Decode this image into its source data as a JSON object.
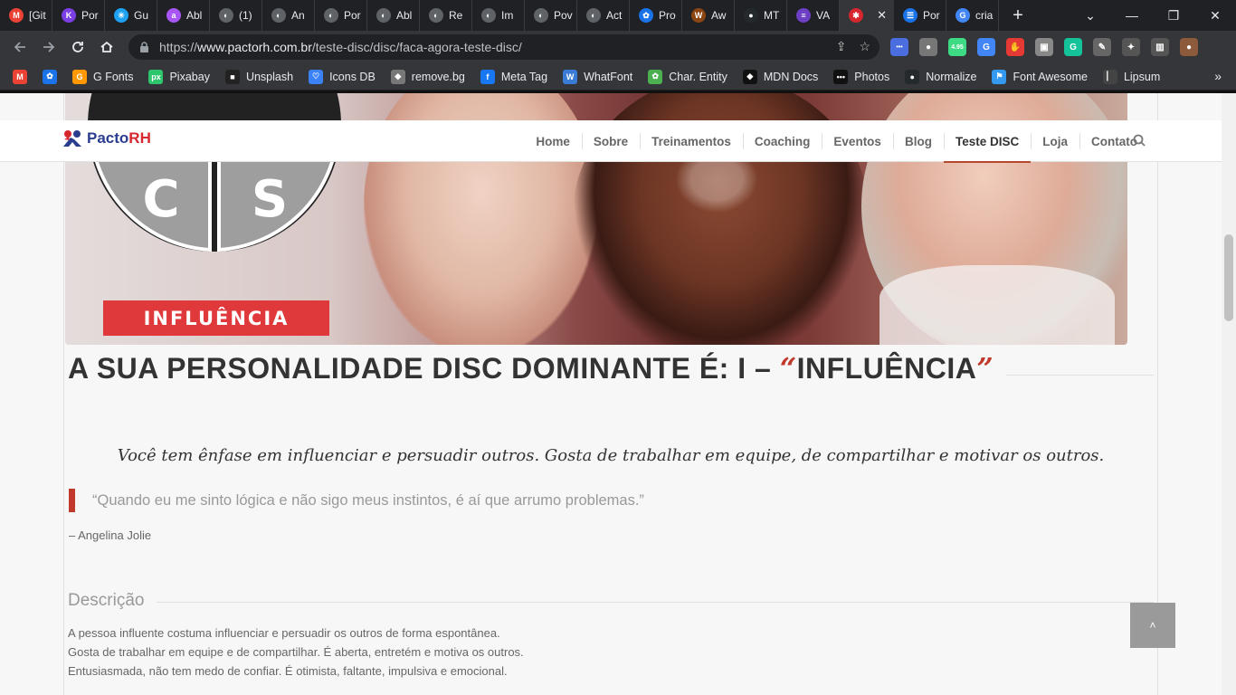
{
  "browser": {
    "tabs": [
      {
        "label": "[Git",
        "fav": "M",
        "color": "#ea4335"
      },
      {
        "label": "Por",
        "fav": "K",
        "color": "#7b3fe4"
      },
      {
        "label": "Gu",
        "fav": "✳",
        "color": "#1da1f2"
      },
      {
        "label": "Abl",
        "fav": "a",
        "color": "#a855f7"
      },
      {
        "label": "(1)",
        "fav": "◐",
        "color": "#5f6368"
      },
      {
        "label": "An",
        "fav": "◐",
        "color": "#5f6368"
      },
      {
        "label": "Por",
        "fav": "◐",
        "color": "#5f6368"
      },
      {
        "label": "Abl",
        "fav": "◐",
        "color": "#5f6368"
      },
      {
        "label": "Re",
        "fav": "◐",
        "color": "#5f6368"
      },
      {
        "label": "Im",
        "fav": "◐",
        "color": "#5f6368"
      },
      {
        "label": "Pov",
        "fav": "◐",
        "color": "#5f6368"
      },
      {
        "label": "Act",
        "fav": "◐",
        "color": "#5f6368"
      },
      {
        "label": "Pro",
        "fav": "✿",
        "color": "#1a73e8"
      },
      {
        "label": "Aw",
        "fav": "W",
        "color": "#8b4513"
      },
      {
        "label": "MT",
        "fav": "●",
        "color": "#24292e"
      },
      {
        "label": "VA",
        "fav": "≡",
        "color": "#6c3fc4"
      },
      {
        "label": "",
        "fav": "✱",
        "color": "#d6262e",
        "active": true
      },
      {
        "label": "Por",
        "fav": "☰",
        "color": "#1a73e8"
      },
      {
        "label": "cria",
        "fav": "G",
        "color": "#4285f4"
      }
    ],
    "new_tab": "+",
    "window_controls": {
      "chevron": "⌄",
      "minimize": "—",
      "restore": "❐",
      "close": "✕"
    },
    "url": {
      "scheme": "https://",
      "host": "www.pactorh.com.br",
      "path": "/teste-disc/disc/faca-agora-teste-disc/"
    },
    "extensions": [
      {
        "icon": "extension-dots-icon",
        "glyph": "•••",
        "color": "#4a6ee0"
      },
      {
        "icon": "extension-ball-icon",
        "glyph": "●",
        "color": "#777"
      },
      {
        "icon": "extension-android-icon",
        "glyph": "4.95",
        "color": "#3ddc84"
      },
      {
        "icon": "extension-translate-icon",
        "glyph": "G",
        "color": "#4285f4"
      },
      {
        "icon": "extension-adblock-icon",
        "glyph": "✋",
        "color": "#e53935"
      },
      {
        "icon": "extension-image-icon",
        "glyph": "▣",
        "color": "#888"
      },
      {
        "icon": "extension-grammarly-icon",
        "glyph": "G",
        "color": "#15c39a"
      },
      {
        "icon": "extension-pen-icon",
        "glyph": "✎",
        "color": "#666"
      },
      {
        "icon": "extensions-puzzle-icon",
        "glyph": "✦",
        "color": "#555"
      },
      {
        "icon": "sidebar-icon",
        "glyph": "▥",
        "color": "#555"
      },
      {
        "icon": "profile-avatar-icon",
        "glyph": "●",
        "color": "#8d5a3c"
      }
    ],
    "bookmarks": [
      {
        "label": "",
        "icon": "M",
        "color": "#ea4335"
      },
      {
        "label": "",
        "icon": "✿",
        "color": "#1a73e8"
      },
      {
        "label": "G Fonts",
        "icon": "G",
        "color": "#ff9800"
      },
      {
        "label": "Pixabay",
        "icon": "px",
        "color": "#2ec66d"
      },
      {
        "label": "Unsplash",
        "icon": "■",
        "color": "#222"
      },
      {
        "label": "Icons DB",
        "icon": "♡",
        "color": "#3b82f6"
      },
      {
        "label": "remove.bg",
        "icon": "◆",
        "color": "#777"
      },
      {
        "label": "Meta Tag",
        "icon": "f",
        "color": "#1877f2"
      },
      {
        "label": "WhatFont",
        "icon": "W",
        "color": "#3a7bd5"
      },
      {
        "label": "Char. Entity",
        "icon": "✿",
        "color": "#4caf50"
      },
      {
        "label": "MDN Docs",
        "icon": "◆",
        "color": "#111"
      },
      {
        "label": "Photos",
        "icon": "•••",
        "color": "#111"
      },
      {
        "label": "Normalize",
        "icon": "●",
        "color": "#24292e"
      },
      {
        "label": "Font Awesome",
        "icon": "⚑",
        "color": "#339af0"
      },
      {
        "label": "Lipsum",
        "icon": "▏",
        "color": "#444"
      }
    ],
    "bookmarks_more": "»"
  },
  "site": {
    "logo": {
      "text_a": "Pacto",
      "text_b": "RH"
    },
    "menu": [
      {
        "label": "Home",
        "active": false
      },
      {
        "label": "Sobre",
        "active": false
      },
      {
        "label": "Treinamentos",
        "active": false
      },
      {
        "label": "Coaching",
        "active": false
      },
      {
        "label": "Eventos",
        "active": false
      },
      {
        "label": "Blog",
        "active": false
      },
      {
        "label": "Teste DISC",
        "active": true
      },
      {
        "label": "Loja",
        "active": false
      },
      {
        "label": "Contato",
        "active": false
      }
    ],
    "accent": "#c0392b"
  },
  "hero": {
    "disc_letters": [
      "C",
      "S"
    ],
    "badge": "INFLUÊNCIA"
  },
  "content": {
    "title_prefix": "A SUA PERSONALIDADE DISC DOMINANTE É: I – ",
    "title_open_quote": "“",
    "title_strong": "INFLUÊNCIA",
    "title_close_quote": "”",
    "lead": "Você tem ênfase em influenciar e persuadir outros. Gosta de trabalhar em equipe, de compartilhar e motivar os outros.",
    "quote": "“Quando eu me sinto lógica e não sigo meus instintos, é aí que arrumo problemas.”",
    "author": "– Angelina Jolie",
    "section_title": "Descrição",
    "description": [
      "A pessoa influente costuma influenciar e persuadir os outros de forma espontânea.",
      "Gosta de trabalhar em equipe e de compartilhar. É aberta, entretém e motiva os outros.",
      "Entusiasmada, não tem medo de confiar. É otimista, faltante, impulsiva e emocional."
    ],
    "back_to_top": "˄"
  }
}
